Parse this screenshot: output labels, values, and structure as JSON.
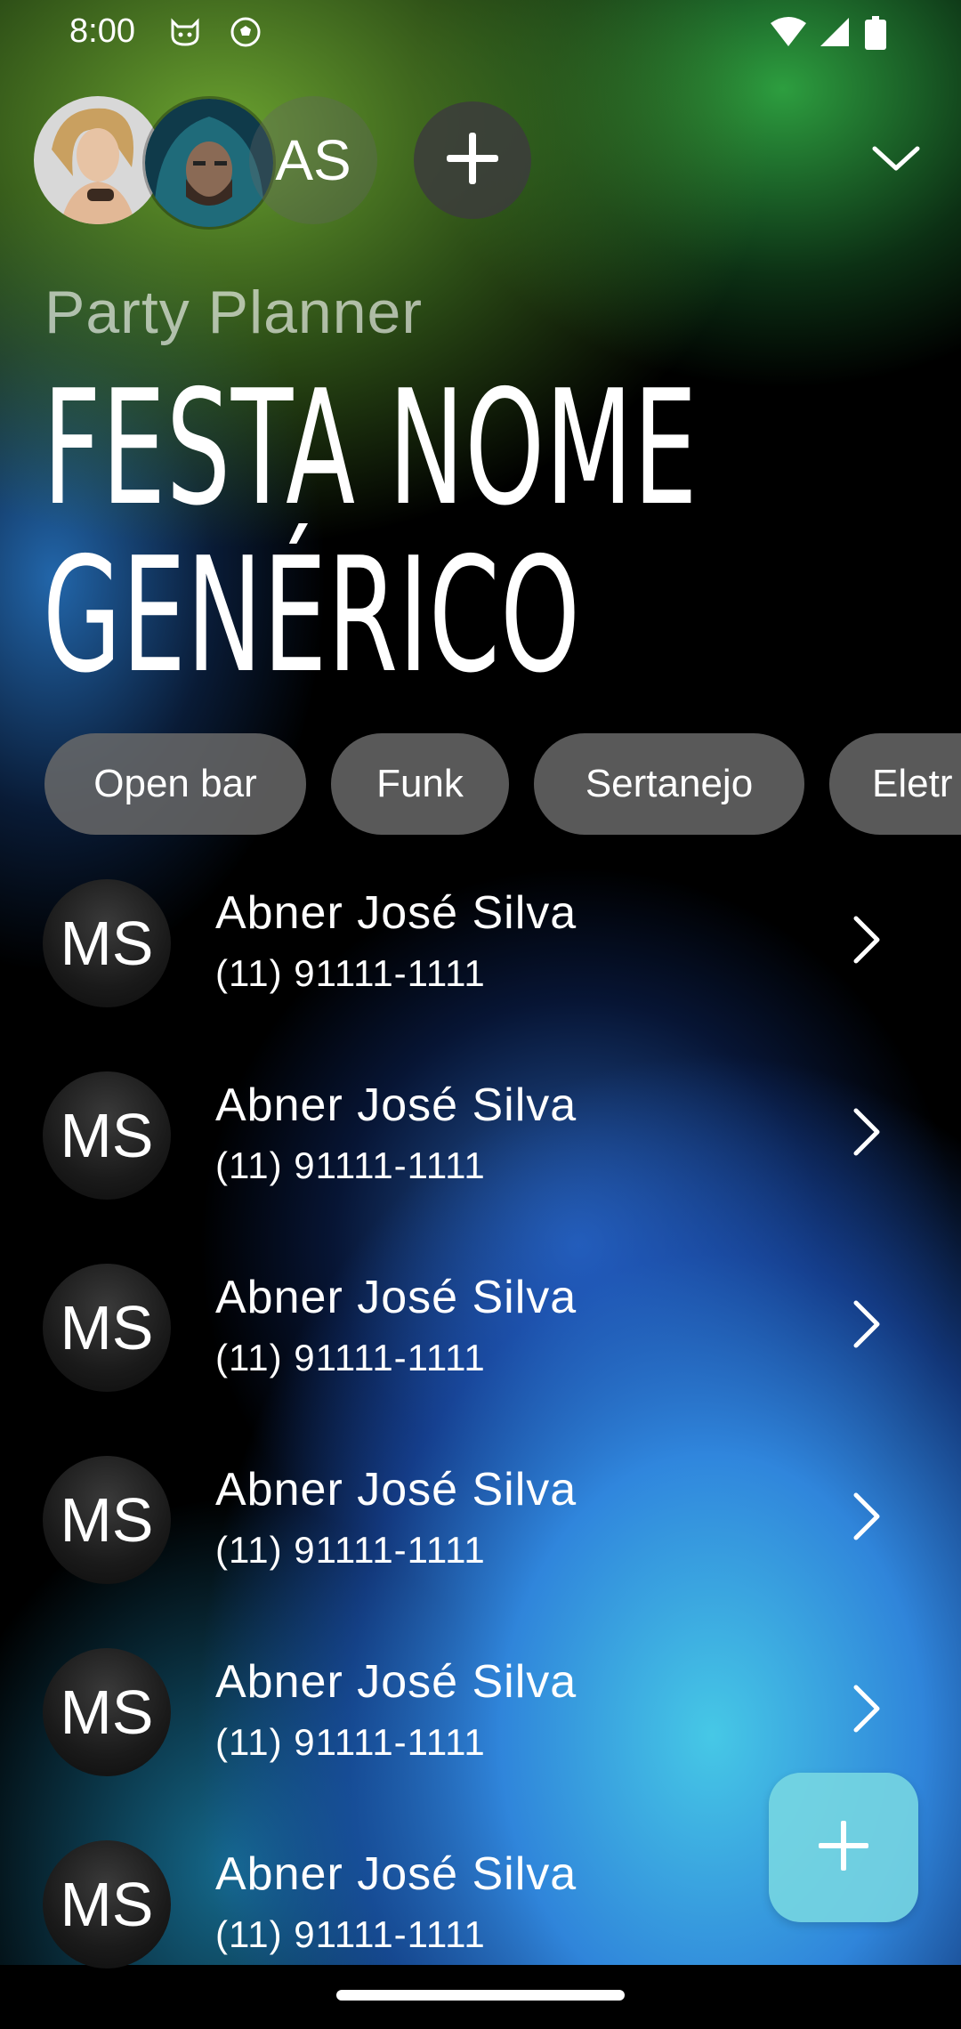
{
  "status_bar": {
    "time": "8:00",
    "icons": [
      "cat-face-icon",
      "soccer-ball-icon",
      "wifi-icon",
      "signal-icon",
      "battery-icon"
    ]
  },
  "members": {
    "avatars": [
      "photo-avatar-woman",
      "photo-avatar-man"
    ],
    "initials": "AS",
    "add_icon": "plus-icon",
    "collapse_icon": "chevron-down-icon"
  },
  "event": {
    "subtitle": "Party Planner",
    "title_line1": "FESTA NOME",
    "title_line2": "GENÉRICO"
  },
  "tags": [
    "Open bar",
    "Funk",
    "Sertanejo",
    "Eletr"
  ],
  "guests": [
    {
      "initials": "MS",
      "name": "Abner José Silva",
      "phone": "(11) 91111-1111"
    },
    {
      "initials": "MS",
      "name": "Abner José Silva",
      "phone": "(11) 91111-1111"
    },
    {
      "initials": "MS",
      "name": "Abner José Silva",
      "phone": "(11) 91111-1111"
    },
    {
      "initials": "MS",
      "name": "Abner José Silva",
      "phone": "(11) 91111-1111"
    },
    {
      "initials": "MS",
      "name": "Abner José Silva",
      "phone": "(11) 91111-1111"
    },
    {
      "initials": "MS",
      "name": "Abner José Silva",
      "phone": "(11) 91111-1111"
    }
  ],
  "fab": {
    "icon": "plus-icon"
  },
  "colors": {
    "chip_bg": "#696969",
    "fab_bg": "#78d7e1",
    "accent_green": "#3aaa46",
    "accent_blue": "#3a8fe6"
  }
}
